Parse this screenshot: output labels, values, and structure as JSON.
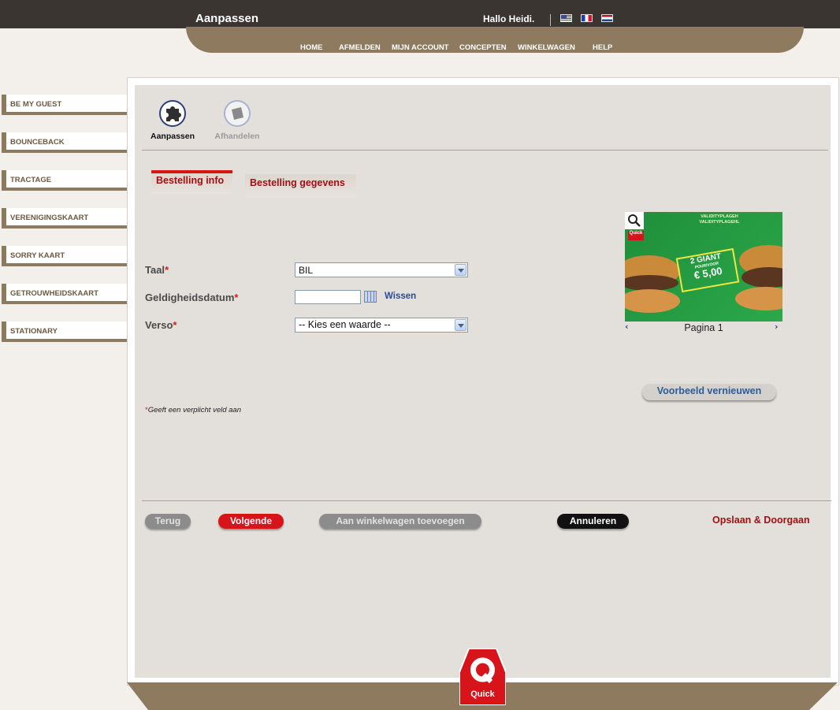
{
  "header": {
    "title": "Aanpassen",
    "greeting": "Hallo Heidi.",
    "languages": [
      "English",
      "Français",
      "Nederlands"
    ]
  },
  "topnav": [
    "HOME",
    "AFMELDEN",
    "MIJN ACCOUNT",
    "CONCEPTEN",
    "WINKELWAGEN",
    "HELP"
  ],
  "sidebar": [
    {
      "label": "BE MY GUEST"
    },
    {
      "label": "BOUNCEBACK"
    },
    {
      "label": "TRACTAGE"
    },
    {
      "label": "VERENIGINGSKAART"
    },
    {
      "label": "SORRY KAART"
    },
    {
      "label": "GETROUWHEIDSKAART"
    },
    {
      "label": "STATIONARY"
    }
  ],
  "steps": [
    {
      "label": "Aanpassen",
      "active": true,
      "icon": "puzzle-icon"
    },
    {
      "label": "Afhandelen",
      "active": false,
      "icon": "flag-icon"
    }
  ],
  "tabs": [
    {
      "label": "Bestelling info",
      "active": true
    },
    {
      "label": "Bestelling gegevens",
      "active": false
    }
  ],
  "form": {
    "taal_label": "Taal",
    "taal_value": "BIL",
    "geldigheid_label": "Geldigheidsdatum",
    "geldigheid_value": "",
    "wissen_label": "Wissen",
    "verso_label": "Verso",
    "verso_value": "-- Kies een waarde --",
    "required_mark": "*",
    "required_note": "Geeft een verplicht veld aan"
  },
  "preview": {
    "page_label": "Pagina 1",
    "refresh_button": "Voorbeeld vernieuwen",
    "promo_line1": "2 GIANT",
    "promo_line2": "POUR/VOOR",
    "promo_price": "€ 5,00",
    "header_line1": "VALIDITYPLAGEH",
    "header_line2": "VALIDITYPLAGEHL",
    "brand": "Quick"
  },
  "actions": {
    "back": "Terug",
    "next": "Volgende",
    "add_to_cart": "Aan winkelwagen toevoegen",
    "cancel": "Annuleren",
    "save_continue": "Opslaan & Doorgaan"
  },
  "footer": {
    "logo_text": "Quick"
  },
  "colors": {
    "brand_brown": "#8e7b5f",
    "header_dark": "#3b3532",
    "accent_red": "#a50d10",
    "link_blue": "#2a4a99"
  }
}
